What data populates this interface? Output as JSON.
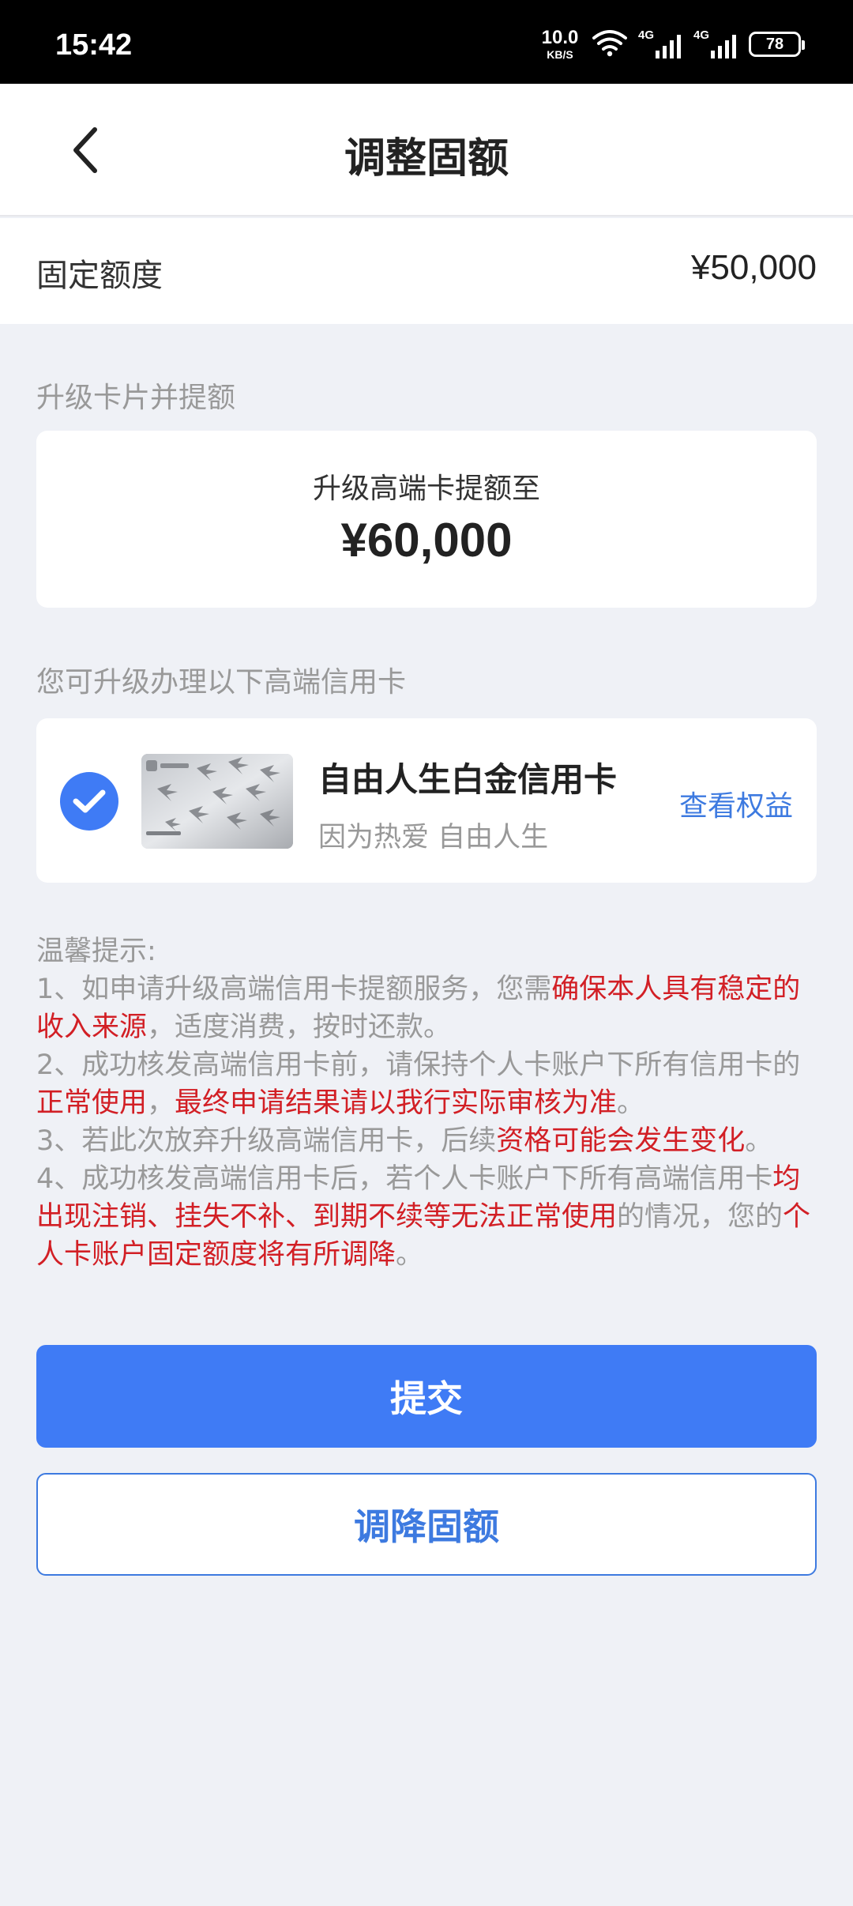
{
  "status_bar": {
    "time": "15:42",
    "net_speed": "10.0",
    "net_unit": "KB/S",
    "signal_1": "4G",
    "signal_2": "4G",
    "battery": "78"
  },
  "header": {
    "title": "调整固额"
  },
  "fixed_limit": {
    "label": "固定额度",
    "value": "¥50,000"
  },
  "upgrade": {
    "section_label": "升级卡片并提额",
    "subtitle": "升级高端卡提额至",
    "amount": "¥60,000"
  },
  "cards": {
    "section_label": "您可升级办理以下高端信用卡",
    "items": [
      {
        "name": "自由人生白金信用卡",
        "slogan": "因为热爱 自由人生",
        "link": "查看权益",
        "selected": true
      }
    ]
  },
  "notice": {
    "title": "温馨提示:",
    "items": [
      {
        "a": "1、如申请升级高端信用卡提额服务，您需",
        "b": "确保本人具有稳定的收入来源",
        "c": "，适度消费，按时还款。"
      },
      {
        "a": "2、成功核发高端信用卡前，请保持个人卡账户下所有信用卡的",
        "b": "正常使用",
        "c": "，",
        "d": "最终申请结果请以我行实际审核为准",
        "e": "。"
      },
      {
        "a": "3、若此次放弃升级高端信用卡，后续",
        "b": "资格可能会发生变化",
        "c": "。"
      },
      {
        "a": "4、成功核发高端信用卡后，若个人卡账户下所有高端信用卡",
        "b": "均出现注销、挂失不补、到期不续等无法正常使用",
        "c": "的情况，您的",
        "d": "个人卡账户固定额度将有所调降",
        "e": "。"
      }
    ]
  },
  "buttons": {
    "submit": "提交",
    "lower": "调降固额"
  },
  "colors": {
    "primary": "#3f7bf5",
    "link": "#3d7ae0",
    "warning_red": "#d21f25",
    "background": "#eff1f6"
  }
}
